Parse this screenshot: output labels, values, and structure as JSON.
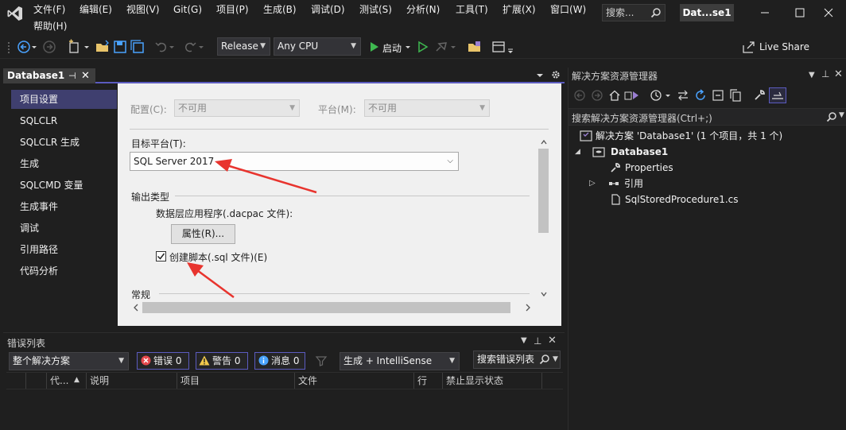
{
  "menubar": {
    "items": [
      "文件(F)",
      "编辑(E)",
      "视图(V)",
      "Git(G)",
      "项目(P)",
      "生成(B)",
      "调试(D)",
      "测试(S)",
      "分析(N)",
      "工具(T)",
      "扩展(X)",
      "窗口(W)",
      "帮助(H)"
    ],
    "search_label": "搜索...",
    "title_badge": "Dat...se1"
  },
  "toolbar": {
    "configuration": "Release",
    "platform": "Any CPU",
    "start_label": "启动",
    "live_share_label": "Live Share"
  },
  "document": {
    "tab_label": "Database1"
  },
  "propnav": {
    "items": [
      "项目设置",
      "SQLCLR",
      "SQLCLR 生成",
      "生成",
      "SQLCMD 变量",
      "生成事件",
      "调试",
      "引用路径",
      "代码分析"
    ]
  },
  "proppage": {
    "config_label": "配置(C):",
    "config_value": "不可用",
    "platform_label": "平台(M):",
    "platform_value": "不可用",
    "target_platform_label": "目标平台(T):",
    "target_platform_value": "SQL Server 2017",
    "output_type_header": "输出类型",
    "dacpac_label": "数据层应用程序(.dacpac 文件):",
    "properties_button": "属性(R)...",
    "create_script_label": "创建脚本(.sql 文件)(E)",
    "general_header": "常规"
  },
  "errorlist": {
    "title": "错误列表",
    "scope": "整个解决方案",
    "errors_label": "错误 0",
    "warnings_label": "警告 0",
    "messages_label": "消息 0",
    "build_filter": "生成 + IntelliSense",
    "search_placeholder": "搜索错误列表",
    "columns": [
      "代...",
      "说明",
      "项目",
      "文件",
      "行",
      "禁止显示状态"
    ]
  },
  "solution_explorer": {
    "title": "解决方案资源管理器",
    "search_placeholder": "搜索解决方案资源管理器(Ctrl+;)",
    "solution_label": "解决方案 'Database1' (1 个项目，共 1 个)",
    "project_label": "Database1",
    "items": [
      "Properties",
      "引用",
      "SqlStoredProcedure1.cs"
    ]
  },
  "colors": {
    "accent": "#5b5bbf",
    "background": "#1f1f1f",
    "property_page": "#f0f0f0",
    "arrow": "#e8342e"
  }
}
